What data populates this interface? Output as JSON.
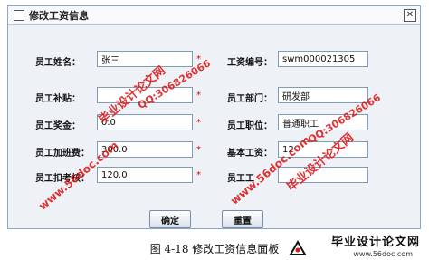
{
  "dialog": {
    "title": "修改工资信息",
    "close_symbol": "✕"
  },
  "form": {
    "left": [
      {
        "label": "员工姓名：",
        "value": "张三",
        "required_mark": "*"
      },
      {
        "label": "员工补贴：",
        "value": "",
        "required_mark": "*"
      },
      {
        "label": "员工奖金：",
        "value": "0.0",
        "required_mark": "*"
      },
      {
        "label": "员工加班费：",
        "value": "300.0",
        "required_mark": "*"
      },
      {
        "label": "员工扣考核：",
        "value": "120.0",
        "required_mark": "*"
      }
    ],
    "right": [
      {
        "label": "工资编号：",
        "value": "swm000021305"
      },
      {
        "label": "员工部门：",
        "value": "研发部"
      },
      {
        "label": "员工职位：",
        "value": "普通职工"
      },
      {
        "label": "基本工资：",
        "value": "12"
      },
      {
        "label": "员工工",
        "value": ""
      }
    ]
  },
  "buttons": {
    "confirm": "确定",
    "reset": "重置"
  },
  "caption": "图 4-18  修改工资信息面板",
  "watermarks": {
    "red_text_1": "毕业设计论文网",
    "qq_1": "QQ:306826066",
    "site_1": "www.56doc.com",
    "red_text_2": "毕业设计论文网",
    "qq_2": "QQ:306826066",
    "site_2": "www.56doc.com",
    "logo_title": "毕业设计论文网",
    "logo_url": "www.56doc.com"
  },
  "colors": {
    "watermark": "#dd1111",
    "required": "#dd0000",
    "window_border": "#8aa7c9"
  }
}
